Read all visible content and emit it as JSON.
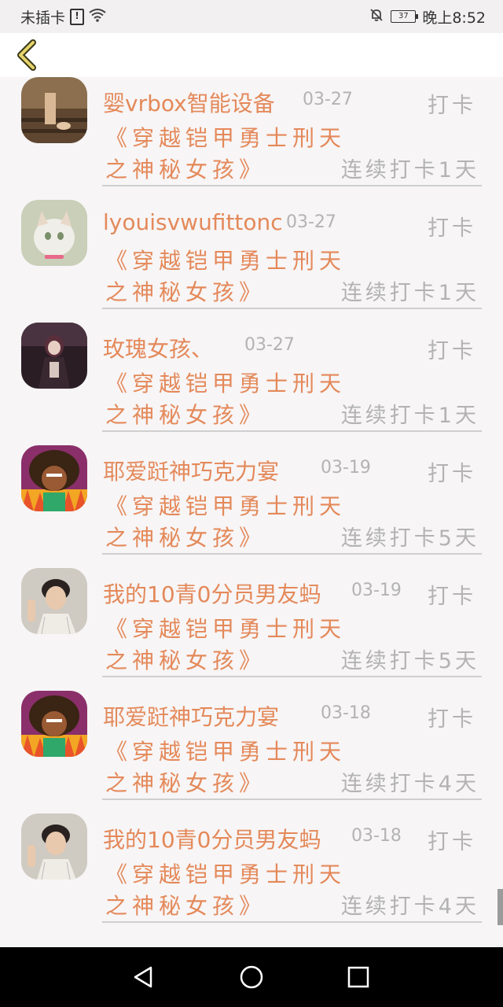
{
  "status_bar": {
    "carrier": "未插卡",
    "sim_icon_label": "!",
    "battery": "37",
    "time": "晚上8:52",
    "icons": [
      "sim-alert-icon",
      "wifi-icon",
      "mute-bell-icon",
      "battery-icon"
    ]
  },
  "header": {
    "back_icon": "chevron-left-icon"
  },
  "list": [
    {
      "user": "婴vrbox智能设备",
      "date": "03-27",
      "action": "打卡",
      "book_line1": "《穿越铠甲勇士刑天",
      "book_line2": "之神秘女孩》",
      "streak": "连续打卡1天",
      "avatar": "avatar-railway-feet"
    },
    {
      "user": "lyouisvwufittonc",
      "date": "03-27",
      "action": "打卡",
      "book_line1": "《穿越铠甲勇士刑天",
      "book_line2": "之神秘女孩》",
      "streak": "连续打卡1天",
      "avatar": "avatar-cat"
    },
    {
      "user": "玫瑰女孩、",
      "date": "03-27",
      "action": "打卡",
      "book_line1": "《穿越铠甲勇士刑天",
      "book_line2": "之神秘女孩》",
      "streak": "连续打卡1天",
      "avatar": "avatar-anime-girl"
    },
    {
      "user": "耶爱跹神巧克力宴",
      "date": "03-19",
      "action": "打卡",
      "book_line1": "《穿越铠甲勇士刑天",
      "book_line2": "之神秘女孩》",
      "streak": "连续打卡5天",
      "avatar": "avatar-cartoon-afro"
    },
    {
      "user": "我的10青0分员男友蚂",
      "date": "03-19",
      "action": "打卡",
      "book_line1": "《穿越铠甲勇士刑天",
      "book_line2": "之神秘女孩》",
      "streak": "连续打卡5天",
      "avatar": "avatar-young-man"
    },
    {
      "user": "耶爱跹神巧克力宴",
      "date": "03-18",
      "action": "打卡",
      "book_line1": "《穿越铠甲勇士刑天",
      "book_line2": "之神秘女孩》",
      "streak": "连续打卡4天",
      "avatar": "avatar-cartoon-afro"
    },
    {
      "user": "我的10青0分员男友蚂",
      "date": "03-18",
      "action": "打卡",
      "book_line1": "《穿越铠甲勇士刑天",
      "book_line2": "之神秘女孩》",
      "streak": "连续打卡4天",
      "avatar": "avatar-young-man"
    }
  ],
  "nav_bar": {
    "icons": [
      "back-triangle-icon",
      "home-circle-icon",
      "recents-square-icon"
    ]
  },
  "colors": {
    "accent": "#e4895a",
    "muted": "#b3b3b3",
    "background": "#f7f5f6"
  }
}
